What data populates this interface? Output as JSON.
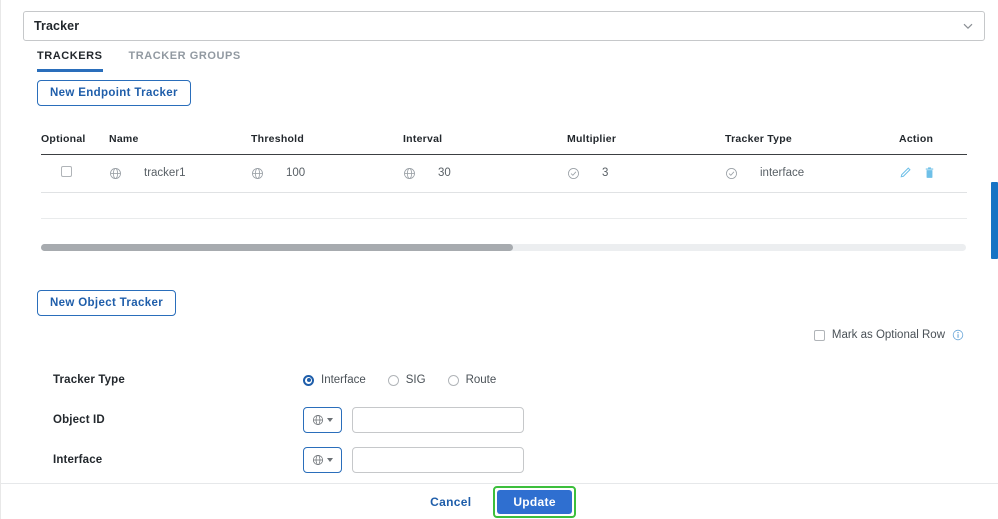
{
  "top_select": {
    "value": "Tracker",
    "chevron_icon": "chevron-down-icon"
  },
  "tabs": [
    {
      "label": "TRACKERS",
      "active": true
    },
    {
      "label": "TRACKER GROUPS",
      "active": false
    }
  ],
  "buttons": {
    "new_endpoint_tracker": "New Endpoint Tracker",
    "new_object_tracker": "New Object Tracker"
  },
  "table": {
    "columns": [
      "Optional",
      "Name",
      "Threshold",
      "Interval",
      "Multiplier",
      "Tracker Type",
      "Action"
    ],
    "rows": [
      {
        "optional": "",
        "name": "tracker1",
        "threshold": "100",
        "interval": "30",
        "multiplier": "3",
        "tracker_type": "interface",
        "name_icon": "globe-icon",
        "threshold_icon": "globe-icon",
        "interval_icon": "globe-icon",
        "multiplier_icon": "check-circle-icon",
        "type_icon": "check-circle-icon",
        "edit_icon": "pencil-icon",
        "delete_icon": "trash-icon"
      }
    ]
  },
  "scrollbars": {
    "horizontal_thumb_percent": "51",
    "vertical_indicator_color": "#1773c4"
  },
  "optional_row": {
    "label": "Mark as Optional Row",
    "info_icon": "info-icon",
    "checked": false
  },
  "form": {
    "tracker_type": {
      "label": "Tracker Type",
      "options": [
        "Interface",
        "SIG",
        "Route"
      ],
      "selected": "Interface"
    },
    "object_id": {
      "label": "Object ID",
      "scope_icon": "globe-icon",
      "value": "",
      "placeholder": ""
    },
    "interface": {
      "label": "Interface",
      "scope_icon": "globe-icon",
      "value": "",
      "placeholder": ""
    }
  },
  "footer": {
    "cancel": "Cancel",
    "update": "Update",
    "update_highlight_color": "#3cbf3c",
    "update_bg_color": "#2f6fd0"
  }
}
